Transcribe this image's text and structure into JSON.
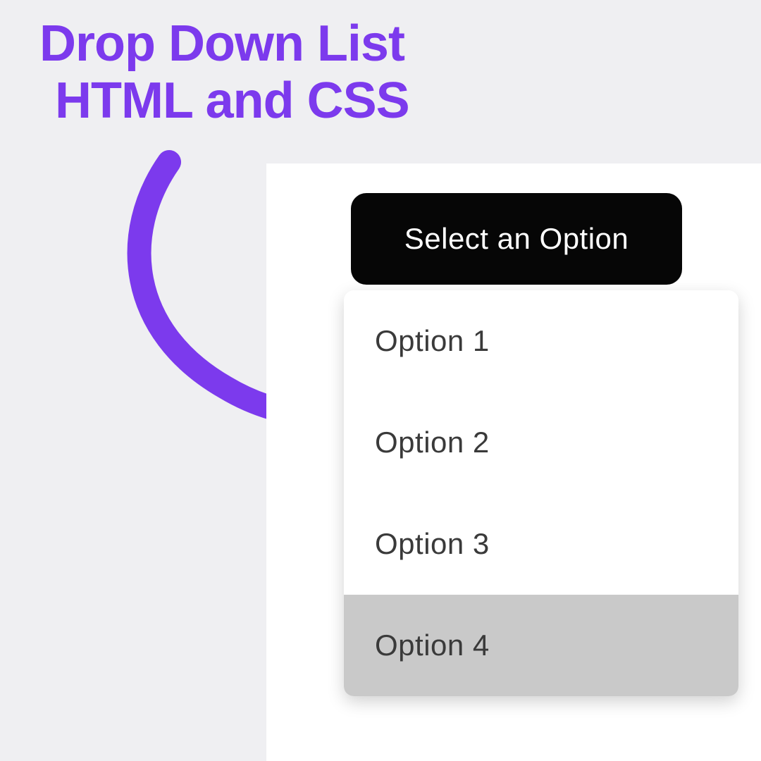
{
  "title": {
    "line1": "Drop Down List",
    "line2": "HTML and CSS"
  },
  "dropdown": {
    "button_label": "Select an Option",
    "options": [
      {
        "label": "Option 1",
        "hover": false
      },
      {
        "label": "Option 2",
        "hover": false
      },
      {
        "label": "Option 3",
        "hover": false
      },
      {
        "label": "Option 4",
        "hover": true
      }
    ]
  },
  "colors": {
    "accent": "#7c3aed",
    "button_bg": "#060606",
    "panel_bg": "#ffffff",
    "page_bg": "#efeff2",
    "hover_bg": "#c9c9c9"
  }
}
